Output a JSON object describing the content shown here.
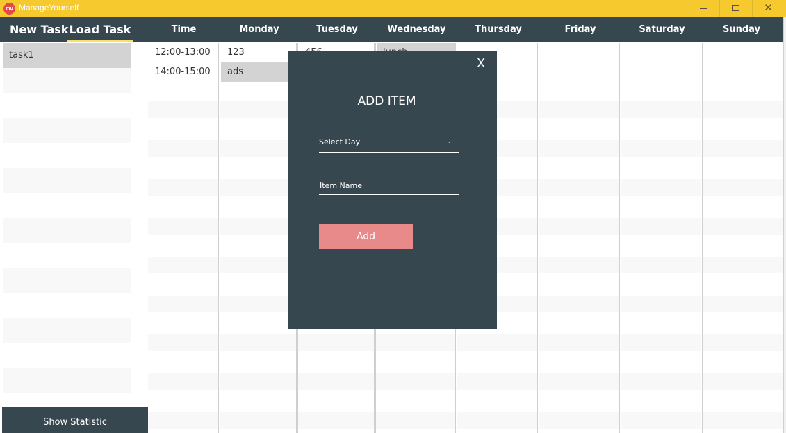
{
  "window": {
    "logo_text": "mu",
    "title": "ManageYourself",
    "minimize_icon": "minimize-icon",
    "maximize_icon": "maximize-icon",
    "close_label": "✕"
  },
  "nav": {
    "new_task": "New Task",
    "load_task": "Load Task"
  },
  "columns": [
    "Time",
    "Monday",
    "Tuesday",
    "Wednesday",
    "Thursday",
    "Friday",
    "Saturday",
    "Sunday"
  ],
  "tasks": [
    "task1"
  ],
  "schedule": {
    "times": [
      "12:00-13:00",
      "14:00-15:00"
    ],
    "monday": [
      "123",
      "ads"
    ],
    "tuesday_partial": "456",
    "wednesday_partial": "lunch"
  },
  "sidebar": {
    "show_statistic": "Show Statistic"
  },
  "modal": {
    "close_label": "X",
    "title": "ADD ITEM",
    "select_day_label": "Select Day",
    "item_name_placeholder": "Item Name",
    "add_label": "Add"
  },
  "colors": {
    "title_bar": "#f6c92f",
    "nav_bar": "#37474f",
    "modal_bg": "#37474f",
    "add_button": "#e88a8a",
    "selected_row": "#d3d3d3",
    "tab_underline": "#f6e26b"
  }
}
